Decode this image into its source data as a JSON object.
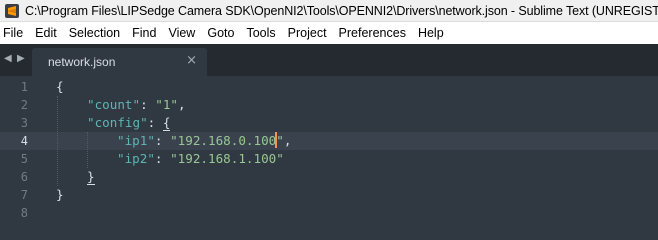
{
  "window": {
    "title": "C:\\Program Files\\LIPSedge Camera SDK\\OpenNI2\\Tools\\OPENNI2\\Drivers\\network.json - Sublime Text (UNREGISTERED)",
    "app_icon": "sublime-text-icon"
  },
  "menu": {
    "items": [
      "File",
      "Edit",
      "Selection",
      "Find",
      "View",
      "Goto",
      "Tools",
      "Project",
      "Preferences",
      "Help"
    ]
  },
  "tabs": {
    "nav_left": "◀",
    "nav_right": "▶",
    "active": {
      "label": "network.json",
      "close": "×"
    }
  },
  "editor": {
    "active_line": 4,
    "line_numbers": [
      "1",
      "2",
      "3",
      "4",
      "5",
      "6",
      "7",
      "8"
    ],
    "lines": {
      "l1": {
        "brace": "{"
      },
      "l2": {
        "key": "\"count\"",
        "colon": ": ",
        "value": "\"1\"",
        "comma": ","
      },
      "l3": {
        "key": "\"config\"",
        "colon": ": ",
        "brace": "{"
      },
      "l4": {
        "key": "\"ip1\"",
        "colon": ": ",
        "value_before_caret": "\"192.168.0.100",
        "value_after_caret": "\"",
        "comma": ","
      },
      "l5": {
        "key": "\"ip2\"",
        "colon": ": ",
        "value": "\"192.168.1.100\""
      },
      "l6": {
        "brace": "}"
      },
      "l7": {
        "brace": "}"
      },
      "l8": {}
    }
  },
  "colors": {
    "background": "#303841",
    "tabbar": "#242a30",
    "key": "#5fb4b4",
    "string": "#99c794",
    "caret": "#f99157",
    "line_number": "#727a84"
  }
}
